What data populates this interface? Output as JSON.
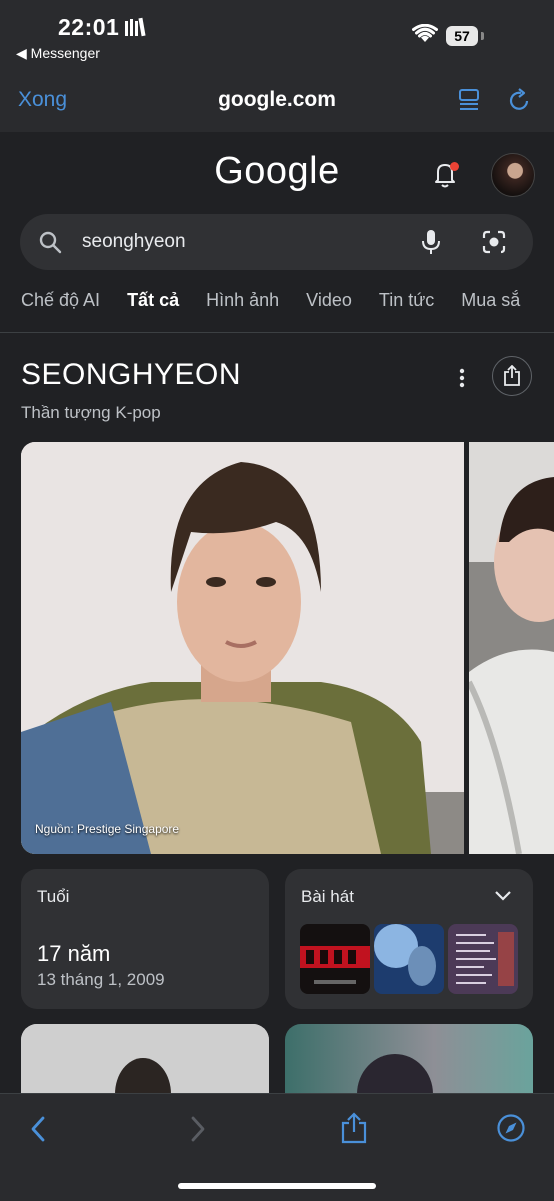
{
  "status_bar": {
    "time": "22:01",
    "back_app": "◀ Messenger",
    "battery": "57"
  },
  "nav": {
    "done_label": "Xong",
    "url": "google.com"
  },
  "header": {
    "logo": "Google"
  },
  "search": {
    "query": "seonghyeon"
  },
  "tabs": [
    "Chế độ AI",
    "Tất cả",
    "Hình ảnh",
    "Video",
    "Tin tức",
    "Mua sắ"
  ],
  "active_tab": "Tất cả",
  "entity": {
    "title": "SEONGHYEON",
    "subtitle": "Thần tượng K-pop",
    "photo_credit": "Nguồn: Prestige Singapore"
  },
  "age_card": {
    "label": "Tuổi",
    "value": "17 năm",
    "birthdate": "13 tháng 1, 2009"
  },
  "songs_card": {
    "label": "Bài hát",
    "thumbnails": [
      {
        "name": "song-thumb-redred",
        "accent": "#c1121f"
      },
      {
        "name": "song-thumb-blue",
        "accent": "#4a8fe0"
      },
      {
        "name": "song-thumb-tracklist",
        "accent": "#7a5a8a"
      }
    ]
  },
  "colors": {
    "link_blue": "#4a90d9",
    "background": "#202124",
    "surface": "#303134",
    "notification": "#ea4335"
  },
  "icons": [
    "book-icon",
    "wifi-icon",
    "reader-icon",
    "reload-icon",
    "bell-icon",
    "search-icon",
    "mic-icon",
    "lens-icon",
    "more-icon",
    "share-icon",
    "chevron-down-icon",
    "back-arrow-icon",
    "forward-arrow-icon",
    "compass-icon"
  ]
}
